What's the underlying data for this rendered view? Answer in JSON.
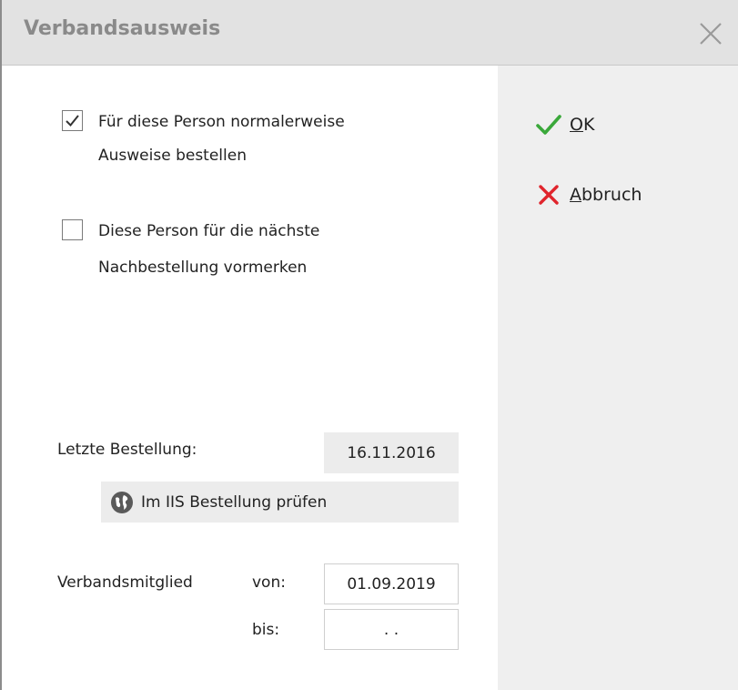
{
  "window": {
    "title": "Verbandsausweis"
  },
  "options": {
    "order_normally": {
      "checked": true,
      "line1": "Für diese Person normalerweise",
      "line2": "Ausweise bestellen"
    },
    "next_reorder": {
      "checked": false,
      "line1": "Diese Person für die nächste",
      "line2": "Nachbestellung vormerken"
    }
  },
  "last_order": {
    "label": "Letzte Bestellung:",
    "value": "16.11.2016"
  },
  "iis_check": {
    "label": "Im IIS Bestellung prüfen",
    "icon": "globe-icon"
  },
  "membership": {
    "label": "Verbandsmitglied",
    "from_label": "von:",
    "from_value": "01.09.2019",
    "to_label": "bis:",
    "to_value": ". ."
  },
  "actions": {
    "ok": {
      "hotkey": "O",
      "rest": "K",
      "icon": "checkmark-icon",
      "color": "#3aa83a"
    },
    "cancel": {
      "hotkey": "A",
      "rest": "bbruch",
      "icon": "cross-icon",
      "color": "#e0242c"
    }
  },
  "colors": {
    "titlebar": "#e2e2e2",
    "side_panel": "#efefef",
    "field_bg": "#ececec"
  }
}
